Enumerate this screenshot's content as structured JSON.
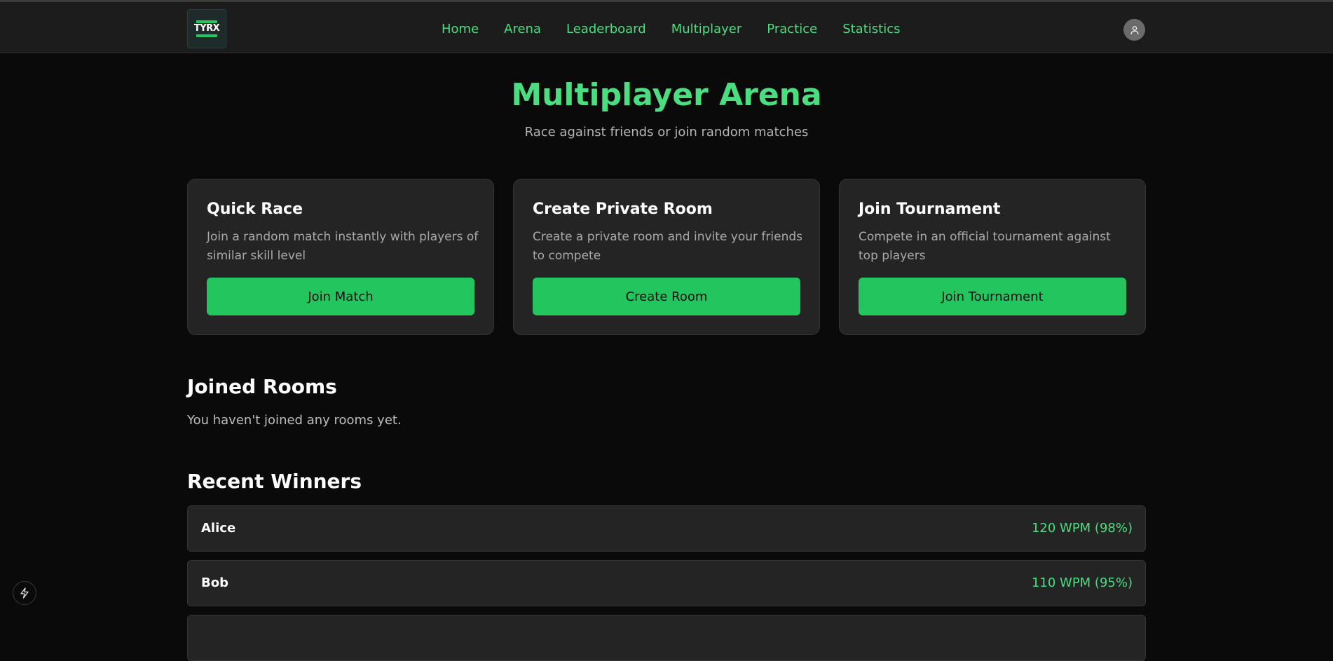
{
  "header": {
    "logo_text": "TYRX",
    "nav": [
      {
        "label": "Home"
      },
      {
        "label": "Arena"
      },
      {
        "label": "Leaderboard"
      },
      {
        "label": "Multiplayer"
      },
      {
        "label": "Practice"
      },
      {
        "label": "Statistics"
      }
    ],
    "avatar_icon": "user-icon"
  },
  "hero": {
    "title": "Multiplayer Arena",
    "subtitle": "Race against friends or join random matches"
  },
  "cards": [
    {
      "title": "Quick Race",
      "description": "Join a random match instantly with players of similar skill level",
      "button": "Join Match"
    },
    {
      "title": "Create Private Room",
      "description": "Create a private room and invite your friends to compete",
      "button": "Create Room"
    },
    {
      "title": "Join Tournament",
      "description": "Compete in an official tournament against top players",
      "button": "Join Tournament"
    }
  ],
  "joined_rooms": {
    "title": "Joined Rooms",
    "empty_text": "You haven't joined any rooms yet."
  },
  "recent_winners": {
    "title": "Recent Winners",
    "rows": [
      {
        "name": "Alice",
        "score": "120 WPM (98%)"
      },
      {
        "name": "Bob",
        "score": "110 WPM (95%)"
      }
    ]
  },
  "colors": {
    "accent": "#4ade80",
    "button": "#22c55e",
    "background": "#0a0a0a",
    "card": "#242424"
  },
  "dev_badge_icon": "lightning-icon"
}
